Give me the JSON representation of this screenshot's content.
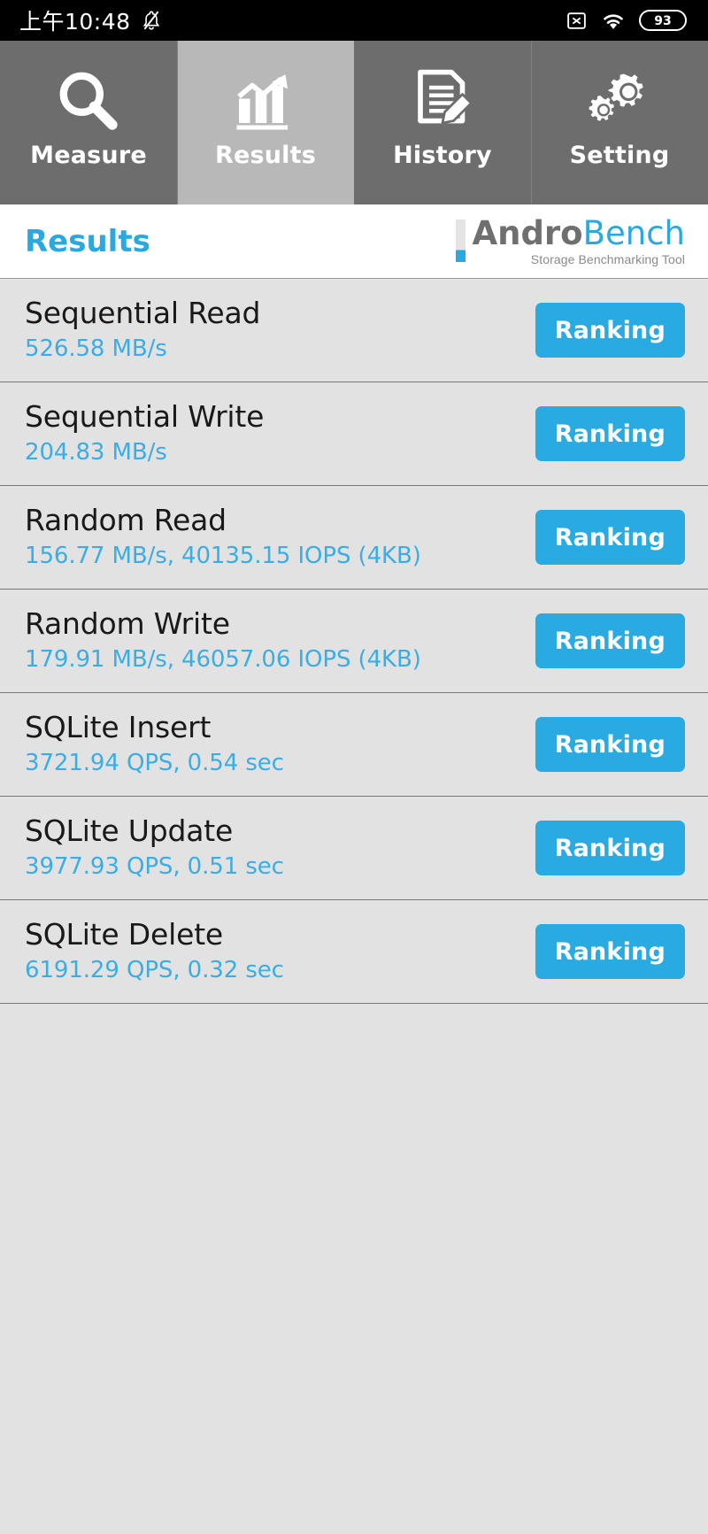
{
  "statusbar": {
    "time": "上午10:48",
    "icons": [
      "bell-muted-icon",
      "sim-x-icon",
      "wifi-icon",
      "battery-icon"
    ],
    "battery_level": "93"
  },
  "tabs": [
    {
      "label": "Measure",
      "icon": "magnifier-icon",
      "active": false
    },
    {
      "label": "Results",
      "icon": "bar-chart-arrow-icon",
      "active": true
    },
    {
      "label": "History",
      "icon": "document-pencil-icon",
      "active": false
    },
    {
      "label": "Setting",
      "icon": "gears-icon",
      "active": false
    }
  ],
  "header": {
    "title": "Results",
    "brand_primary": "Andro",
    "brand_secondary": "Bench",
    "brand_subtitle": "Storage Benchmarking Tool"
  },
  "colors": {
    "accent": "#29abe2",
    "value_text": "#3aaee4",
    "tab_inactive_bg": "#6d6d6d",
    "tab_active_bg": "#b8b8b8",
    "list_bg": "#e2e2e2"
  },
  "results": [
    {
      "name": "Sequential Read",
      "value": "526.58 MB/s",
      "button": "Ranking"
    },
    {
      "name": "Sequential Write",
      "value": "204.83 MB/s",
      "button": "Ranking"
    },
    {
      "name": "Random Read",
      "value": "156.77 MB/s, 40135.15 IOPS (4KB)",
      "button": "Ranking"
    },
    {
      "name": "Random Write",
      "value": "179.91 MB/s, 46057.06 IOPS (4KB)",
      "button": "Ranking"
    },
    {
      "name": "SQLite Insert",
      "value": "3721.94 QPS, 0.54 sec",
      "button": "Ranking"
    },
    {
      "name": "SQLite Update",
      "value": "3977.93 QPS, 0.51 sec",
      "button": "Ranking"
    },
    {
      "name": "SQLite Delete",
      "value": "6191.29 QPS, 0.32 sec",
      "button": "Ranking"
    }
  ]
}
